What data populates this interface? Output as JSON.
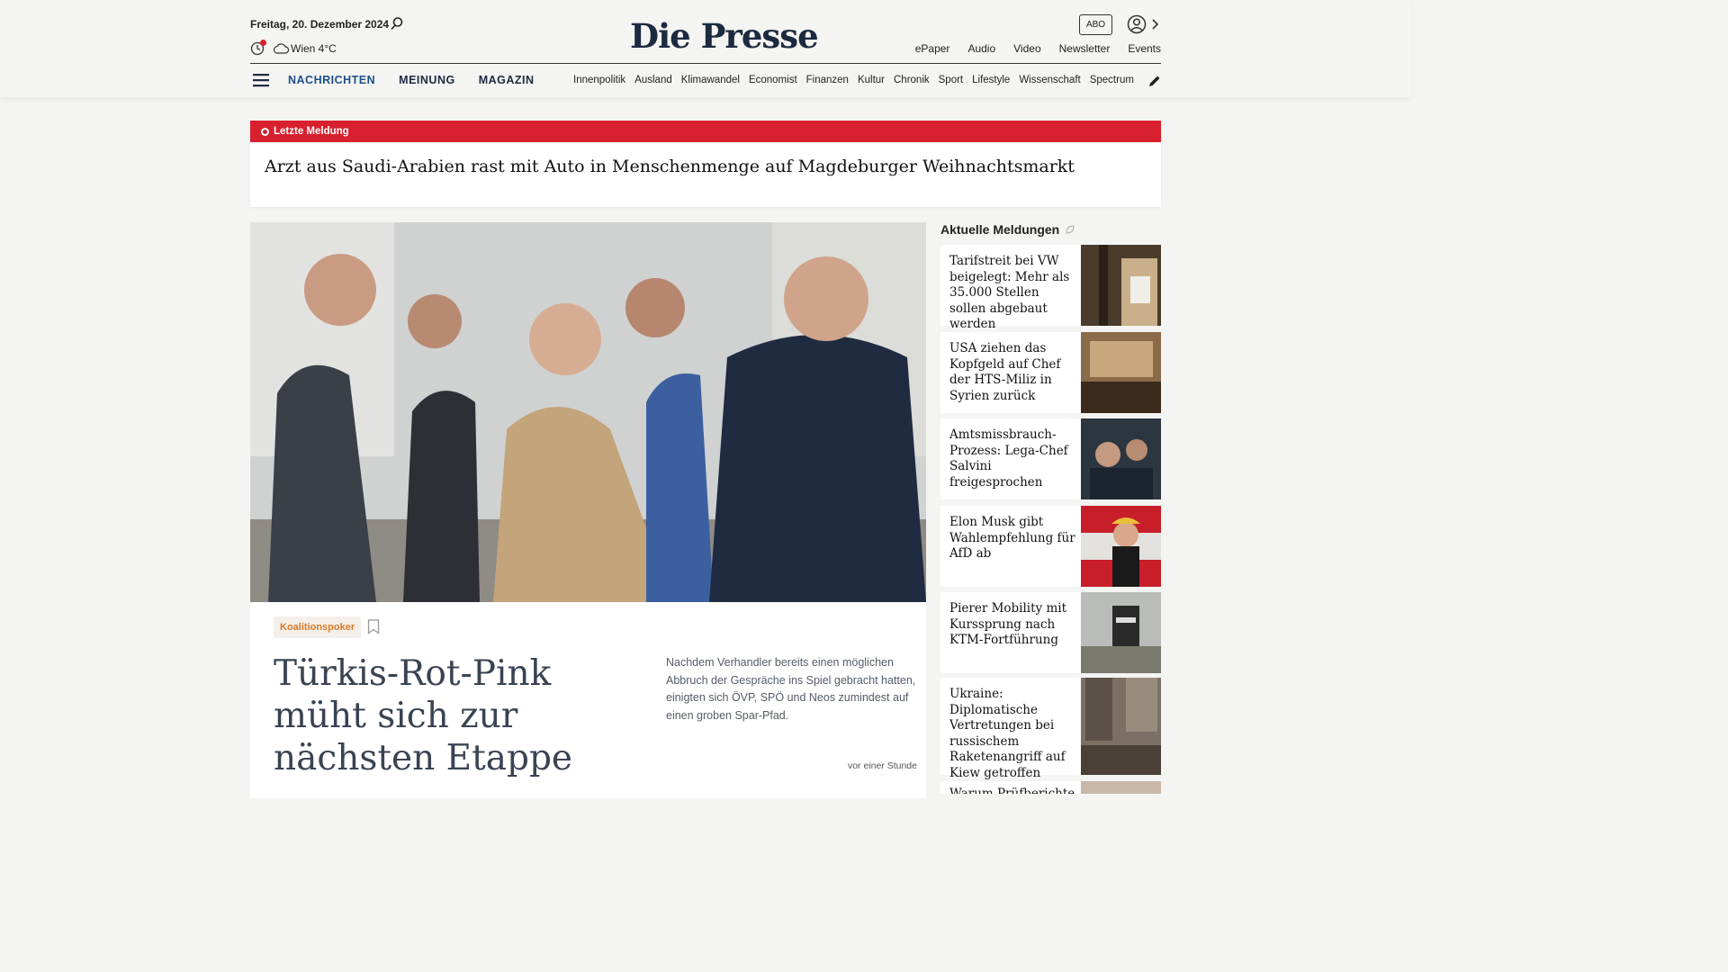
{
  "header": {
    "date": "Freitag, 20. Dezember 2024",
    "weather": "Wien 4°C",
    "logo": "Die Presse",
    "abo": "ABO",
    "toplinks": [
      "ePaper",
      "Audio",
      "Video",
      "Newsletter",
      "Events"
    ],
    "mainnav": [
      "NACHRICHTEN",
      "MEINUNG",
      "MAGAZIN"
    ],
    "subnav": [
      "Innenpolitik",
      "Ausland",
      "Klimawandel",
      "Economist",
      "Finanzen",
      "Kultur",
      "Chronik",
      "Sport",
      "Lifestyle",
      "Wissenschaft",
      "Spectrum"
    ]
  },
  "breaking": {
    "label": "Letzte Meldung",
    "title": "Arzt aus Saudi-Arabien rast mit Auto in Menschenmenge auf Magdeburger Weihnachtsmarkt"
  },
  "lead": {
    "tag": "Koalitionspoker",
    "title": "Türkis-Rot-Pink müht sich zur nächsten Etappe",
    "teaser": "Nachdem Verhandler bereits einen möglichen Abbruch der Gespräche ins Spiel gebracht hatten, einigten sich ÖVP, SPÖ und Neos zumindest auf einen groben Spar-Pfad.",
    "time": "vor einer Stunde"
  },
  "sidebar": {
    "title": "Aktuelle Meldungen",
    "items": [
      {
        "text": "Tarifstreit bei VW beigelegt: Mehr als 35.000 Stellen sollen abgebaut werden"
      },
      {
        "text": "USA ziehen das Kopfgeld auf Chef der HTS-Miliz in Syrien zurück"
      },
      {
        "text": "Amtsmissbrauch-Prozess: Lega-Chef Salvini freigesprochen"
      },
      {
        "text": "Elon Musk gibt Wahlempfehlung für AfD ab"
      },
      {
        "text": "Pierer Mobility mit Kurssprung nach KTM-Fortführung"
      },
      {
        "text": "Ukraine: Diplomatische Vertretungen bei russischem Raketenangriff auf Kiew getroffen"
      },
      {
        "text": "Warum Prüfberichte"
      }
    ]
  },
  "colors": {
    "breaking": "#d8202e",
    "navy": "#1c2a40",
    "tag": "#d87a2a"
  }
}
